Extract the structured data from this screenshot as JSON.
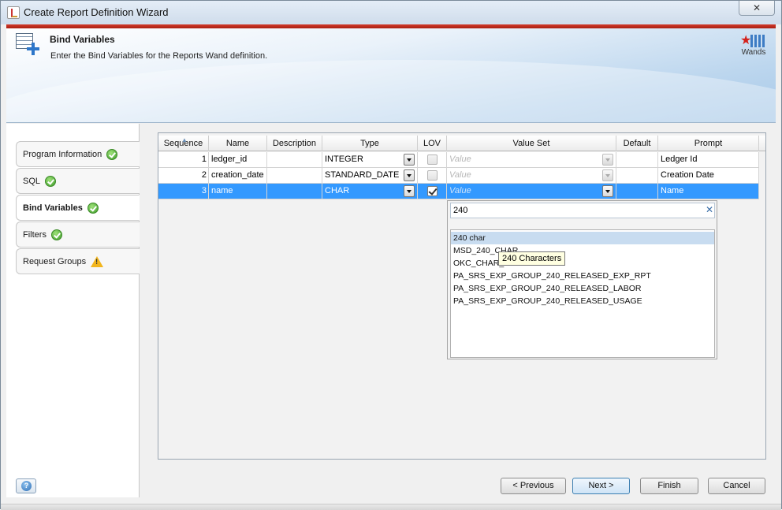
{
  "window": {
    "title": "Create Report Definition Wizard",
    "close_glyph": "✕"
  },
  "header": {
    "title": "Bind Variables",
    "subtitle": "Enter the Bind Variables for the Reports Wand definition.",
    "icon": "grid-plus-icon",
    "brand_label": "Wands"
  },
  "nav": {
    "items": [
      {
        "label": "Program Information",
        "status": "complete"
      },
      {
        "label": "SQL",
        "status": "complete"
      },
      {
        "label": "Bind Variables",
        "status": "complete"
      },
      {
        "label": "Filters",
        "status": "complete"
      },
      {
        "label": "Request Groups",
        "status": "warning"
      }
    ],
    "help_glyph": "?"
  },
  "table": {
    "columns": [
      "Sequence",
      "Name",
      "Description",
      "Type",
      "LOV",
      "Value Set",
      "Default",
      "Prompt"
    ],
    "rows": [
      {
        "sequence": "1",
        "name": "ledger_id",
        "description": "",
        "type": "INTEGER",
        "lov": false,
        "value_set": "Value",
        "default": "",
        "prompt": "Ledger Id"
      },
      {
        "sequence": "2",
        "name": "creation_date",
        "description": "",
        "type": "STANDARD_DATE",
        "lov": false,
        "value_set": "Value",
        "default": "",
        "prompt": "Creation Date"
      },
      {
        "sequence": "3",
        "name": "name",
        "description": "",
        "type": "CHAR",
        "lov": true,
        "value_set": "Value",
        "default": "",
        "prompt": "Name"
      }
    ],
    "selected_row": 3
  },
  "value_set_popup": {
    "search": "240",
    "clear_glyph": "✕",
    "options": [
      "240 char",
      "MSD_240_CHAR",
      "OKC_CHAR_240",
      "PA_SRS_EXP_GROUP_240_RELEASED_EXP_RPT",
      "PA_SRS_EXP_GROUP_240_RELEASED_LABOR",
      "PA_SRS_EXP_GROUP_240_RELEASED_USAGE"
    ],
    "highlighted": "240 char",
    "tooltip": "240 Characters"
  },
  "buttons": {
    "previous": "< Previous",
    "next": "Next >",
    "finish": "Finish",
    "cancel": "Cancel"
  },
  "colors": {
    "accent_band": "#c0281a",
    "selection": "#3399ff",
    "complete": "#3d9b2a",
    "warning": "#f2b51c"
  }
}
